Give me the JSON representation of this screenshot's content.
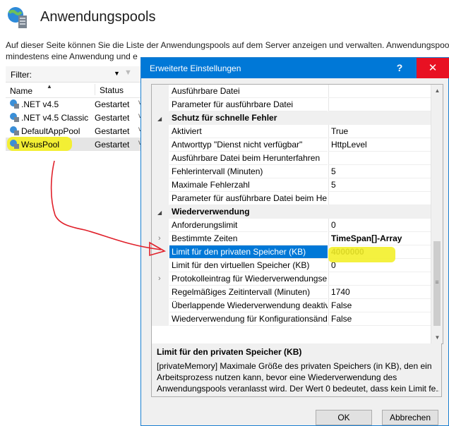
{
  "page": {
    "title": "Anwendungspools",
    "description_lines": [
      "Auf dieser Seite können Sie die Liste der Anwendungspools auf dem Server anzeigen und verwalten. Anwendungspools",
      "mindestens eine Anwendung und e"
    ],
    "filter_label": "Filter:",
    "columns": {
      "name": "Name",
      "status": "Status"
    },
    "pools": [
      {
        "name": ".NET v4.5",
        "status": "Gestartet"
      },
      {
        "name": ".NET v4.5 Classic",
        "status": "Gestartet"
      },
      {
        "name": "DefaultAppPool",
        "status": "Gestartet"
      },
      {
        "name": "WsusPool",
        "status": "Gestartet"
      }
    ]
  },
  "dialog": {
    "title": "Erweiterte Einstellungen",
    "help_label": "?",
    "close_label": "✕",
    "rows": [
      {
        "name": "Ausführbare Datei",
        "value": ""
      },
      {
        "name": "Parameter für ausführbare Datei",
        "value": ""
      },
      {
        "name": "Schutz für schnelle Fehler",
        "category": true
      },
      {
        "name": "Aktiviert",
        "value": "True"
      },
      {
        "name": "Antworttyp \"Dienst nicht verfügbar\"",
        "value": "HttpLevel"
      },
      {
        "name": "Ausführbare Datei beim Herunterfahren",
        "value": ""
      },
      {
        "name": "Fehlerintervall (Minuten)",
        "value": "5"
      },
      {
        "name": "Maximale Fehlerzahl",
        "value": "5"
      },
      {
        "name": "Parameter für ausführbare Datei beim Her",
        "value": ""
      },
      {
        "name": "Wiederverwendung",
        "category": true
      },
      {
        "name": "Anforderungslimit",
        "value": "0"
      },
      {
        "name": "Bestimmte Zeiten",
        "value": "TimeSpan[]-Array",
        "expandable": true
      },
      {
        "name": "Limit für den privaten Speicher (KB)",
        "value": "4000000",
        "selected": true
      },
      {
        "name": "Limit für den virtuellen Speicher (KB)",
        "value": "0"
      },
      {
        "name": "Protokolleintrag für Wiederverwendungse",
        "value": "",
        "expandable": true
      },
      {
        "name": "Regelmäßiges Zeitintervall (Minuten)",
        "value": "1740"
      },
      {
        "name": "Überlappende Wiederverwendung deaktiv",
        "value": "False"
      },
      {
        "name": "Wiederverwendung für Konfigurationsänd",
        "value": "False"
      }
    ],
    "description": {
      "title": "Limit für den privaten Speicher (KB)",
      "lines": [
        "[privateMemory] Maximale Größe des privaten Speichers (in KB), den ein",
        "Arbeitsprozess nutzen kann, bevor eine Wiederverwendung des",
        "Anwendungspools veranlasst wird. Der Wert 0 bedeutet, dass kein Limit fe..."
      ]
    },
    "ok_label": "OK",
    "cancel_label": "Abbrechen"
  },
  "colors": {
    "accent": "#0078d7",
    "close": "#e81123",
    "highlight": "#f3ef2a",
    "annotation": "#e0202a"
  }
}
